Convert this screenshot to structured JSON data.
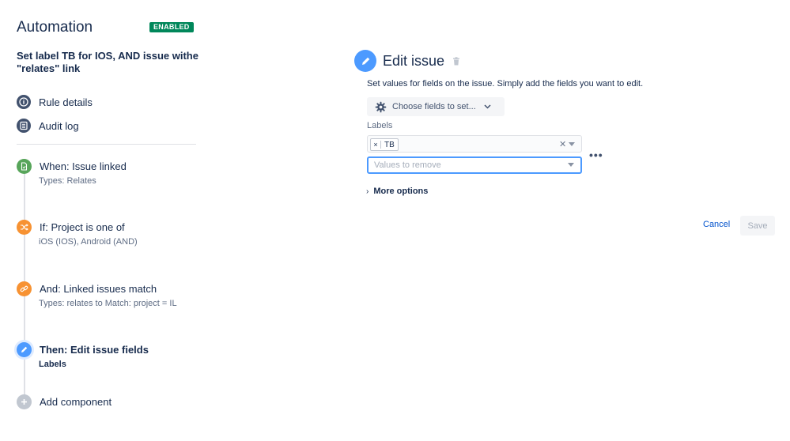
{
  "sidebar": {
    "title": "Automation",
    "status_badge": "ENABLED",
    "rule_name": "Set label TB for IOS, AND issue withe \"relates\" link",
    "nav": [
      {
        "label": "Rule details",
        "icon": "info-icon"
      },
      {
        "label": "Audit log",
        "icon": "list-icon"
      }
    ],
    "steps": [
      {
        "title": "When: Issue linked",
        "subtitle": "Types: Relates",
        "icon": "document-icon",
        "color": "#57a55a"
      },
      {
        "title": "If: Project is one of",
        "subtitle": "iOS (IOS), Android (AND)",
        "icon": "shuffle-icon",
        "color": "#f79232"
      },
      {
        "title": "And: Linked issues match",
        "subtitle": "Types: relates to Match: project = IL",
        "icon": "link-icon",
        "color": "#f79232"
      },
      {
        "title": "Then: Edit issue fields",
        "subtitle": "Labels",
        "icon": "pencil-icon",
        "color": "#4c9aff"
      },
      {
        "title": "Add component",
        "subtitle": "",
        "icon": "plus-icon",
        "color": "#c1c7d0"
      }
    ]
  },
  "editor": {
    "title": "Edit issue",
    "description": "Set values for fields on the issue. Simply add the fields you want to edit.",
    "choose_fields_label": "Choose fields to set...",
    "field_label": "Labels",
    "tags": [
      "TB"
    ],
    "remove_placeholder": "Values to remove",
    "more_options_label": "More options",
    "cancel_label": "Cancel",
    "save_label": "Save"
  },
  "colors": {
    "accent": "#4c9aff",
    "enabled": "#00875a",
    "link": "#0052cc"
  }
}
